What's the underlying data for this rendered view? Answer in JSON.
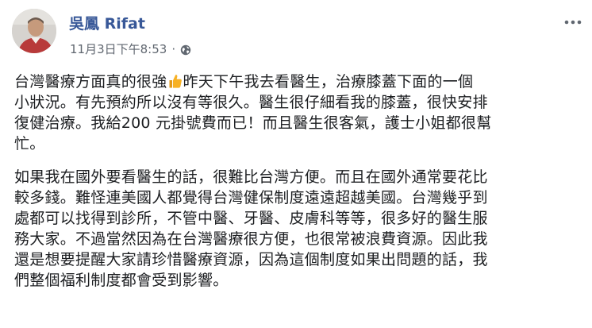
{
  "post": {
    "author": "吳鳳 Rifat",
    "timestamp": "11月3日下午8:53",
    "separator": "·",
    "privacy_icon": "globe-icon",
    "more_icon": "more-options-icon",
    "paragraphs": [
      {
        "lines": [
          {
            "before": "台灣醫療方面真的很強",
            "emoji": "thumbs-up",
            "after": "昨天下午我去看醫生，治療膝蓋下面的一個"
          },
          {
            "text": "小狀況。有先預約所以沒有等很久。醫生很仔細看我的膝蓋，很快安排"
          },
          {
            "text": "復健治療。我給200 元掛號費而已！而且醫生很客氣，護士小姐都很幫"
          },
          {
            "text": "忙。"
          }
        ]
      },
      {
        "lines": [
          {
            "text": "如果我在國外要看醫生的話，很難比台灣方便。而且在國外通常要花比"
          },
          {
            "text": "較多錢。難怪連美國人都覺得台灣健保制度遠遠超越美國。台灣幾乎到"
          },
          {
            "text": "處都可以找得到診所，不管中醫、牙醫、皮膚科等等，很多好的醫生服"
          },
          {
            "text": "務大家。不過當然因為在台灣醫療很方便，也很常被浪費資源。因此我"
          },
          {
            "text": "還是想要提醒大家請珍惜醫療資源，因為這個制度如果出問題的話，我"
          },
          {
            "text": "們整個福利制度都會受到影響。"
          }
        ]
      }
    ]
  },
  "colors": {
    "author": "#385898",
    "meta": "#606770",
    "text": "#1c1e21",
    "emoji": "#f7b125"
  }
}
